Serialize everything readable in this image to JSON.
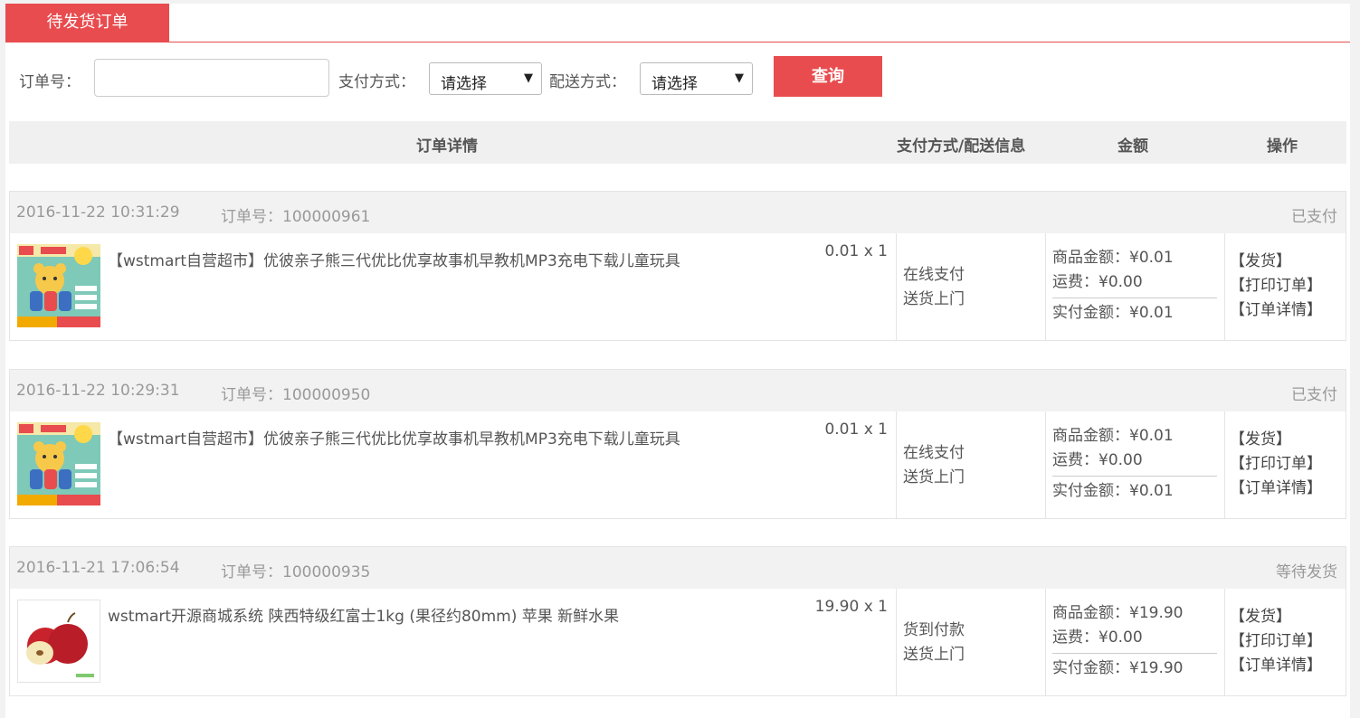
{
  "tabs": {
    "active_label": "待发货订单"
  },
  "filter": {
    "order_no_label": "订单号：",
    "order_no_value": "",
    "payment_label": "支付方式：",
    "payment_selected": "请选择",
    "delivery_label": "配送方式：",
    "delivery_selected": "请选择",
    "query_button": "查询"
  },
  "columns": {
    "detail": "订单详情",
    "payment_delivery": "支付方式/配送信息",
    "amount": "金额",
    "actions": "操作"
  },
  "orders": [
    {
      "datetime": "2016-11-22 10:31:29",
      "order_no": "订单号：100000961",
      "status": "已支付",
      "product": "【wstmart自营超市】优彼亲子熊三代优比优享故事机早教机MP3充电下载儿童玩具",
      "qty": "0.01 x 1",
      "payment": "在线支付",
      "delivery": "送货上门",
      "goods_amount": "商品金额：¥0.01",
      "shipping": "运费：¥0.00",
      "paid": "实付金额：¥0.01",
      "image": "toy-product-image",
      "actions": [
        "【发货】",
        "【打印订单】",
        "【订单详情】"
      ]
    },
    {
      "datetime": "2016-11-22 10:29:31",
      "order_no": "订单号：100000950",
      "status": "已支付",
      "product": "【wstmart自营超市】优彼亲子熊三代优比优享故事机早教机MP3充电下载儿童玩具",
      "qty": "0.01 x 1",
      "payment": "在线支付",
      "delivery": "送货上门",
      "goods_amount": "商品金额：¥0.01",
      "shipping": "运费：¥0.00",
      "paid": "实付金额：¥0.01",
      "image": "toy-product-image",
      "actions": [
        "【发货】",
        "【打印订单】",
        "【订单详情】"
      ]
    },
    {
      "datetime": "2016-11-21 17:06:54",
      "order_no": "订单号：100000935",
      "status": "等待发货",
      "product": "wstmart开源商城系统 陕西特级红富士1kg (果径约80mm) 苹果 新鲜水果",
      "qty": "19.90 x 1",
      "payment": "货到付款",
      "delivery": "送货上门",
      "goods_amount": "商品金额：¥19.90",
      "shipping": "运费：¥0.00",
      "paid": "实付金额：¥19.90",
      "image": "apple-product-image",
      "actions": [
        "【发货】",
        "【打印订单】",
        "【订单详情】"
      ]
    }
  ],
  "colors": {
    "accent": "#e84c4f",
    "header_bg": "#f0f0f0",
    "muted_text": "#999999"
  }
}
